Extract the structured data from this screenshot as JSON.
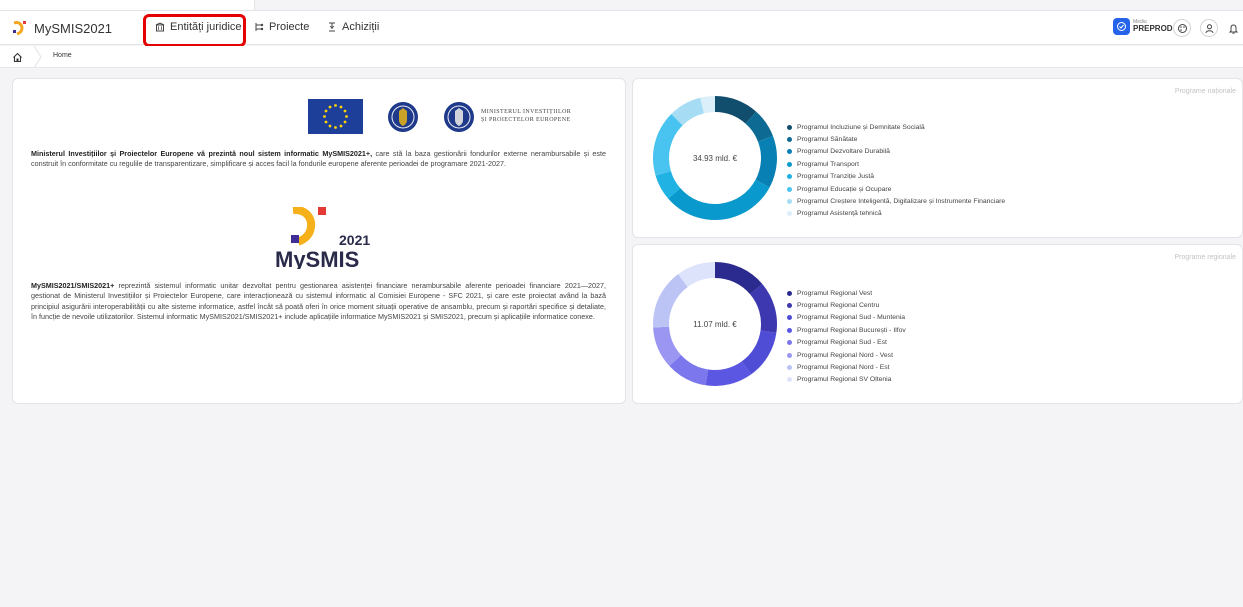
{
  "app": {
    "name": "MySMIS2021"
  },
  "nav": {
    "items": [
      {
        "label": "Entități juridice"
      },
      {
        "label": "Proiecte"
      },
      {
        "label": "Achiziții"
      }
    ],
    "env": {
      "small": "Mediu",
      "name": "PREPROD"
    }
  },
  "breadcrumb": {
    "home": "Home"
  },
  "intro": {
    "ministry_line1": "MINISTERUL INVESTIȚIILOR",
    "ministry_line2": "ȘI PROIECTELOR EUROPENE",
    "para1_bold": "Ministerul Investițiilor și Proiectelor Europene vă prezintă noul sistem informatic MySMIS2021+,",
    "para1_rest": " care stă la baza gestionării fondurilor externe nerambursabile și este construit în conformitate cu regulile de transparentizare, simplificare și acces facil la fondurile europene aferente perioadei de programare 2021-2027.",
    "logo_year": "2021",
    "logo_name": "MySMIS",
    "para2_bold": "MySMIS2021/SMIS2021+",
    "para2_rest": " reprezintă sistemul informatic unitar dezvoltat pentru gestionarea asistenței financiare nerambursabile aferente perioadei financiare 2021—2027, gestionat de Ministerul Investițiilor și Proiectelor Europene, care interacționează cu sistemul informatic al Comisiei Europene - SFC 2021, și care este proiectat având la bază principiul asigurării interoperabilității cu alte sisteme informatice, astfel încât să poată oferi în orice moment situații operative de ansamblu, precum și raportări specifice și detaliate, în funcție de nevoile utilizatorilor. Sistemul informatic MySMIS2021/SMIS2021+ include aplicațiile informatice MySMIS2021 și SMIS2021, precum și aplicațiile informatice conexe."
  },
  "chart_data": [
    {
      "type": "pie",
      "title": "Programe naționale",
      "center_label": "34.93 mld. €",
      "categories": [
        "Programul Incluziune și Demnitate Socială",
        "Programul Sănătate",
        "Programul Dezvoltare Durabilă",
        "Programul Transport",
        "Programul Tranziție Justă",
        "Programul Educație și Ocupare",
        "Programul Creștere Inteligentă, Digitalizare și Instrumente Financiare",
        "Programul Asistență tehnică"
      ],
      "values": [
        3.9,
        2.6,
        4.6,
        10.4,
        2.3,
        5.8,
        2.9,
        1.3
      ],
      "colors": [
        "#114e6e",
        "#0d6a93",
        "#0880b4",
        "#0a99cd",
        "#1fb2e3",
        "#49c3ef",
        "#a6ddf5",
        "#dbeffa"
      ]
    },
    {
      "type": "pie",
      "title": "Programe regionale",
      "center_label": "11.07 mld. €",
      "categories": [
        "Programul Regional Vest",
        "Programul Regional Centru",
        "Programul Regional Sud - Muntenia",
        "Programul Regional București - Ilfov",
        "Programul Regional Sud - Est",
        "Programul Regional Nord - Vest",
        "Programul Regional Nord - Est",
        "Programul Regional SV Oltenia"
      ],
      "values": [
        1.53,
        1.49,
        1.42,
        1.36,
        1.19,
        1.21,
        1.75,
        1.12
      ],
      "colors": [
        "#2b2a8f",
        "#3d38b0",
        "#4f4cd6",
        "#5b57e3",
        "#7c77ec",
        "#9a96f2",
        "#bcc4f5",
        "#dde3fa"
      ]
    }
  ]
}
